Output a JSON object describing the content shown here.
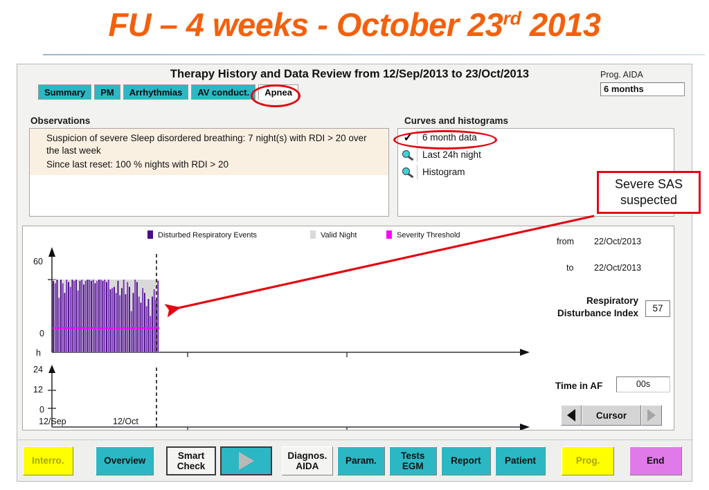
{
  "slide": {
    "title_main": "FU – 4 weeks - October 23",
    "title_sup": "rd",
    "title_tail": " 2013"
  },
  "header": {
    "title": "Therapy History and Data Review from 12/Sep/2013 to 23/Oct/2013",
    "prog_label": "Prog. AIDA",
    "prog_value": "6 months"
  },
  "tabs": [
    {
      "label": "Summary",
      "selected": false
    },
    {
      "label": "PM",
      "selected": false
    },
    {
      "label": "Arrhythmias",
      "selected": false
    },
    {
      "label": "AV conduct.",
      "selected": false
    },
    {
      "label": "Apnea",
      "selected": true
    }
  ],
  "observations": {
    "title": "Observations",
    "line1": "Suspicion of severe Sleep disordered breathing: 7 night(s) with RDI > 20 over the last week",
    "line2": "Since last reset: 100 % nights with RDI > 20"
  },
  "curves": {
    "title": "Curves and histograms",
    "items": [
      {
        "label": "6 month data",
        "icon": "check-icon",
        "selected": true
      },
      {
        "label": "Last 24h night",
        "icon": "magnifier-icon",
        "selected": false
      },
      {
        "label": "Histogram",
        "icon": "magnifier-icon",
        "selected": false
      }
    ]
  },
  "annotation": {
    "callout_line1": "Severe SAS",
    "callout_line2": "suspected",
    "color": "#e30613"
  },
  "side_panel": {
    "from_label": "from",
    "from_value": "22/Oct/2013",
    "to_label": "to",
    "to_value": "22/Oct/2013",
    "rdi_label": "Respiratory\nDisturbance Index",
    "rdi_value": "57",
    "time_in_af_label": "Time in AF",
    "time_in_af_value": "00s",
    "cursor_label": "Cursor"
  },
  "buttons": [
    {
      "label": "Interro.",
      "style": "yellow"
    },
    {
      "label": "Overview",
      "style": "teal"
    },
    {
      "label": "Smart\nCheck",
      "style": "white framed"
    },
    {
      "label": "",
      "style": "teal framed play"
    },
    {
      "label": "Diagnos.\nAIDA",
      "style": "white"
    },
    {
      "label": "Param.",
      "style": "teal"
    },
    {
      "label": "Tests\nEGM",
      "style": "teal"
    },
    {
      "label": "Report",
      "style": "teal"
    },
    {
      "label": "Patient",
      "style": "teal"
    },
    {
      "label": "Prog.",
      "style": "yellow"
    },
    {
      "label": "End",
      "style": "violet"
    }
  ],
  "chart_data": [
    {
      "type": "bar",
      "title": "Disturbed Respiratory Events per night",
      "xlabel": "",
      "ylabel": "",
      "ylim": [
        0,
        70
      ],
      "yticks": [
        0,
        60
      ],
      "ytick_labels": [
        "0",
        "60"
      ],
      "grid": false,
      "legend": [
        {
          "name": "Disturbed Respiratory Events",
          "color": "#4b0d87"
        },
        {
          "name": "Valid Night",
          "color": "#d9d9d9"
        },
        {
          "name": "Severity Threshold",
          "color": "#ff00ff"
        }
      ],
      "threshold_line": {
        "name": "Severity Threshold",
        "value": 20,
        "color": "#ff00ff"
      },
      "valid_night_band": {
        "value": 60,
        "color": "#d9d9d9"
      },
      "cursor_marker": {
        "position_index": 52,
        "style": "dashed"
      },
      "categories_note": "nightly values from 12/Sep to 23/Oct",
      "values": [
        59,
        57,
        60,
        45,
        60,
        57,
        49,
        60,
        58,
        54,
        60,
        59,
        60,
        51,
        59,
        60,
        56,
        59,
        60,
        60,
        59,
        60,
        57,
        59,
        60,
        60,
        59,
        61,
        58,
        60,
        52,
        53,
        54,
        49,
        59,
        47,
        53,
        60,
        48,
        58,
        54,
        34,
        49,
        60,
        58,
        46,
        41,
        53,
        49,
        38,
        44,
        30,
        46,
        52,
        43,
        59
      ],
      "xtick_labels": [
        "12/Sep",
        "12/Oct"
      ]
    },
    {
      "type": "bar",
      "title": "Time in AF per day",
      "xlabel": "",
      "ylabel": "h",
      "ylim": [
        0,
        28
      ],
      "yticks": [
        0,
        12,
        24
      ],
      "ytick_labels": [
        "0",
        "12",
        "24"
      ],
      "grid": false,
      "values": [],
      "xtick_labels": [
        "12/Sep",
        "12/Oct"
      ],
      "cursor_marker": {
        "position_index": 52,
        "style": "dashed"
      }
    }
  ]
}
